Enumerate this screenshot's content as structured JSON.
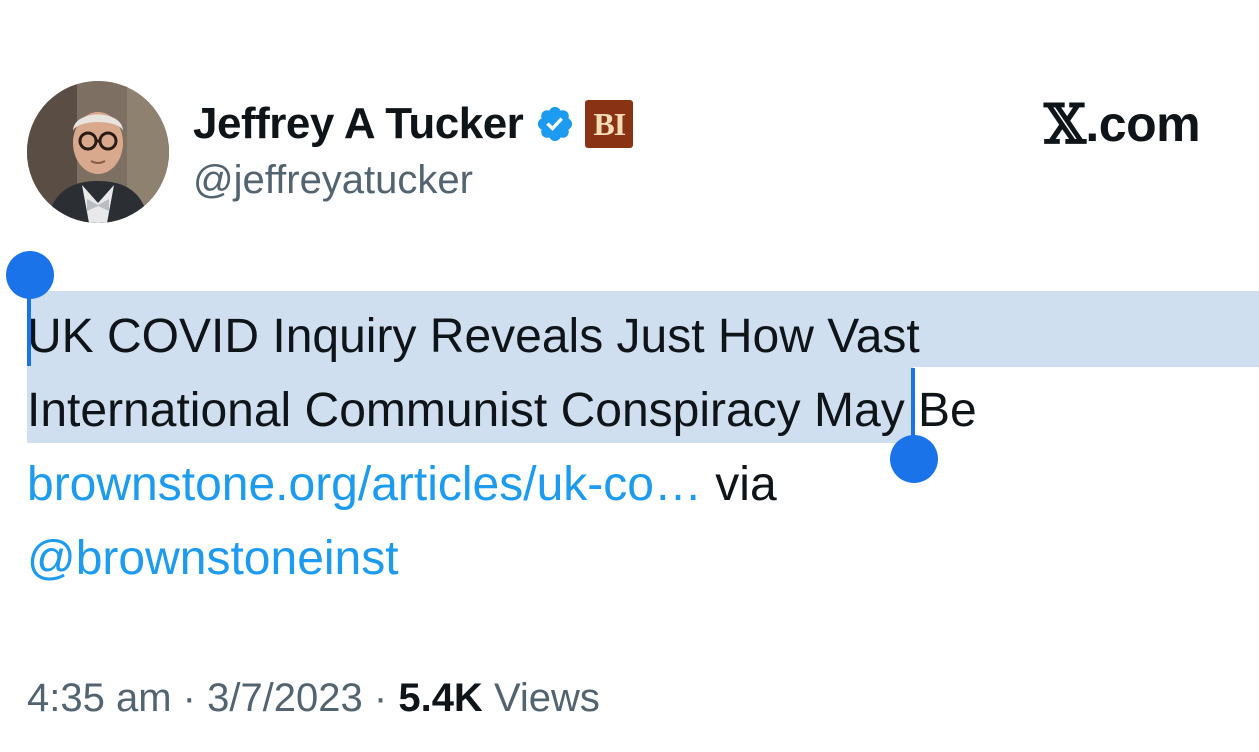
{
  "author": {
    "display_name": "Jeffrey A Tucker",
    "handle": "@jeffreyatucker",
    "verified_color": "#1d9bf0",
    "affiliate_badge_text": "BI"
  },
  "brand": {
    "label": ".com",
    "x_glyph": "𝕏"
  },
  "tweet": {
    "line1": "UK COVID Inquiry Reveals Just How Vast",
    "line2_selected": "International Communist Conspiracy",
    "line2_rest": " May Be",
    "link": "brownstone.org/articles/uk-co…",
    "via": " via",
    "mention": "@brownstoneinst"
  },
  "meta": {
    "time": "4:35 am",
    "sep1": " · ",
    "date": "3/7/2023",
    "sep2": " · ",
    "views_count": "5.4K",
    "views_label": " Views"
  },
  "colors": {
    "link": "#1d9bf0",
    "selection": "#cfdff0",
    "selection_handle": "#1a73e8",
    "secondary_text": "#536471"
  }
}
